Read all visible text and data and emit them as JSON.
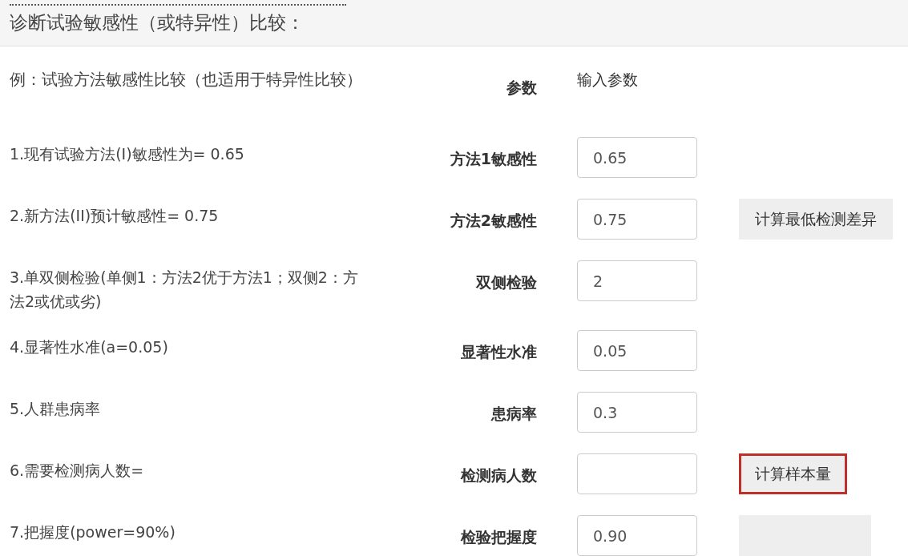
{
  "title": "诊断试验敏感性（或特异性）比较：",
  "header": {
    "example": "例：试验方法敏感性比较（也适用于特异性比较）",
    "param": "参数",
    "input": "输入参数"
  },
  "rows": [
    {
      "description": "1.现有试验方法(I)敏感性为= 0.65",
      "label": "方法1敏感性",
      "value": "0.65"
    },
    {
      "description": "2.新方法(II)预计敏感性= 0.75",
      "label": "方法2敏感性",
      "value": "0.75",
      "button": {
        "label": "计算最低检测差异",
        "highlighted": false
      }
    },
    {
      "description": "3.单双侧检验(单侧1：方法2优于方法1；双侧2：方法2或优或劣)",
      "label": "双侧检验",
      "value": "2"
    },
    {
      "description": "4.显著性水准(a=0.05)",
      "label": "显著性水准",
      "value": "0.05"
    },
    {
      "description": "5.人群患病率",
      "label": "患病率",
      "value": "0.3"
    },
    {
      "description": "6.需要检测病人数=",
      "label": "检测病人数",
      "value": "",
      "button": {
        "label": "计算样本量",
        "highlighted": true
      }
    },
    {
      "description": "7.把握度(power=90%)",
      "label": "检验把握度",
      "value": "0.90",
      "button": {
        "highlighted": false
      }
    }
  ]
}
